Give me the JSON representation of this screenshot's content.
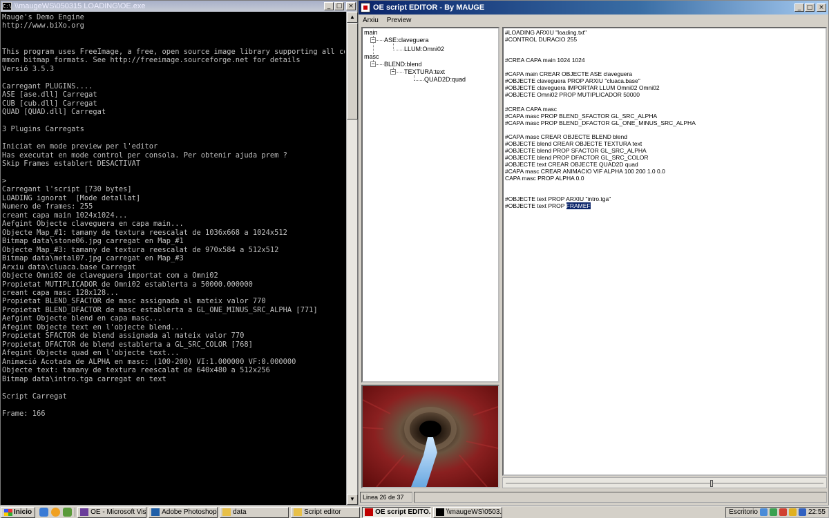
{
  "console": {
    "title": "\\\\maugeWS\\050315 LOADING\\OE.exe",
    "icon": "cmd-icon",
    "lines": [
      "Mauge's Demo Engine",
      "http://www.biXo.org",
      "",
      "",
      "This program uses FreeImage, a free, open source image library supporting all co",
      "mmon bitmap formats. See http://freeimage.sourceforge.net for details",
      "Versió 3.5.3",
      "",
      "Carregant PLUGINS....",
      "ASE [ase.dll] Carregat",
      "CUB [cub.dll] Carregat",
      "QUAD [QUAD.dll] Carregat",
      "",
      "3 Plugins Carregats",
      "",
      "Iniciat en mode preview per l'editor",
      "Has executat en mode control per consola. Per obtenir ajuda prem ?",
      "Skip Frames establert DESACTIVAT",
      "",
      ">",
      "Carregant l'script [730 bytes]",
      "LOADING ignorat  [Mode detallat]",
      "Numero de frames: 255",
      "creant capa main 1024x1024...",
      "Aefgint Objecte claveguera en capa main...",
      "Objecte Map_#1: tamany de textura reescalat de 1036x668 a 1024x512",
      "Bitmap data\\stone06.jpg carregat en Map_#1",
      "Objecte Map_#3: tamany de textura reescalat de 970x584 a 512x512",
      "Bitmap data\\metal07.jpg carregat en Map_#3",
      "Arxiu data\\cluaca.base Carregat",
      "Objecte Omni02 de claveguera importat com a Omni02",
      "Propietat MUTIPLICADOR de Omni02 establerta a 50000.000000",
      "creant capa masc 128x128...",
      "Propietat BLEND_SFACTOR de masc assignada al mateix valor 770",
      "Propietat BLEND_DFACTOR de masc establerta a GL_ONE_MINUS_SRC_ALPHA [771]",
      "Aefgint Objecte blend en capa masc...",
      "Afegint Objecte text en l'objecte blend...",
      "Propietat SFACTOR de blend assignada al mateix valor 770",
      "Propietat DFACTOR de blend establerta a GL_SRC_COLOR [768]",
      "Afegint Objecte quad en l'objecte text...",
      "Animació Acotada de ALPHA en masc: (100-200) VI:1.000000 VF:0.000000",
      "Objecte text: tamany de textura reescalat de 640x480 a 512x256",
      "Bitmap data\\intro.tga carregat en text",
      "",
      "Script Carregat",
      "",
      "Frame: 166"
    ]
  },
  "editor": {
    "title": "OE script EDITOR - By MAUGE",
    "menu": [
      "Arxiu",
      "Preview"
    ],
    "tree": {
      "main": "main",
      "ase": "ASE:claveguera",
      "llum": "LLUM:Omni02",
      "masc": "masc",
      "blend": "BLEND:blend",
      "textura": "TEXTURA:text",
      "quad": "QUAD2D:quad"
    },
    "code_lines": [
      "#LOADING ARXIU \"loading.txt\"",
      "#CONTROL DURACIO 255",
      "",
      "",
      "#CREA CAPA main 1024 1024",
      "",
      "#CAPA main CREAR OBJECTE ASE claveguera",
      "#OBJECTE claveguera PROP ARXIU \"cluaca.base\"",
      "#OBJECTE claveguera IMPORTAR LLUM Omni02 Omni02",
      "#OBJECTE Omni02 PROP MUTIPLICADOR 50000",
      "",
      "#CREA CAPA masc",
      "#CAPA masc PROP BLEND_SFACTOR GL_SRC_ALPHA",
      "#CAPA masc PROP BLEND_DFACTOR GL_ONE_MINUS_SRC_ALPHA",
      "",
      "#CAPA masc CREAR OBJECTE BLEND blend",
      "#OBJECTE blend CREAR OBJECTE TEXTURA text",
      "#OBJECTE blend PROP SFACTOR GL_SRC_ALPHA",
      "#OBJECTE blend PROP DFACTOR GL_SRC_COLOR",
      "#OBJECTE text CREAR OBJECTE QUAD2D quad",
      "#CAPA masc CREAR ANIMACIO VIF ALPHA 100 200 1.0 0.0",
      "CAPA masc PROP ALPHA 0.0",
      "",
      "",
      "#OBJECTE text PROP ARXIU \"intro.tga\""
    ],
    "last_line_prefix": "#OBJECTE text PROP ",
    "last_line_selected": "FRAMEF",
    "status": "Linea 26 de 37",
    "preview_image": "tunnel-render"
  },
  "taskbar": {
    "start": "Inicio",
    "buttons": [
      {
        "label": "OE - Microsoft Visu...",
        "icon": "visual-studio-icon",
        "color": "#6a3d9a"
      },
      {
        "label": "Adobe Photoshop",
        "icon": "photoshop-icon",
        "color": "#1f5fa8"
      },
      {
        "label": "data",
        "icon": "folder-icon",
        "color": "#e8c048"
      },
      {
        "label": "Script editor",
        "icon": "folder-icon",
        "color": "#e8c048"
      },
      {
        "label": "OE script EDITO...",
        "icon": "app-icon",
        "color": "#c00000",
        "active": true
      },
      {
        "label": "\\\\maugeWS\\0503...",
        "icon": "cmd-icon",
        "color": "#000000"
      }
    ],
    "escritorio": "Escritorio",
    "clock": "22:55"
  }
}
